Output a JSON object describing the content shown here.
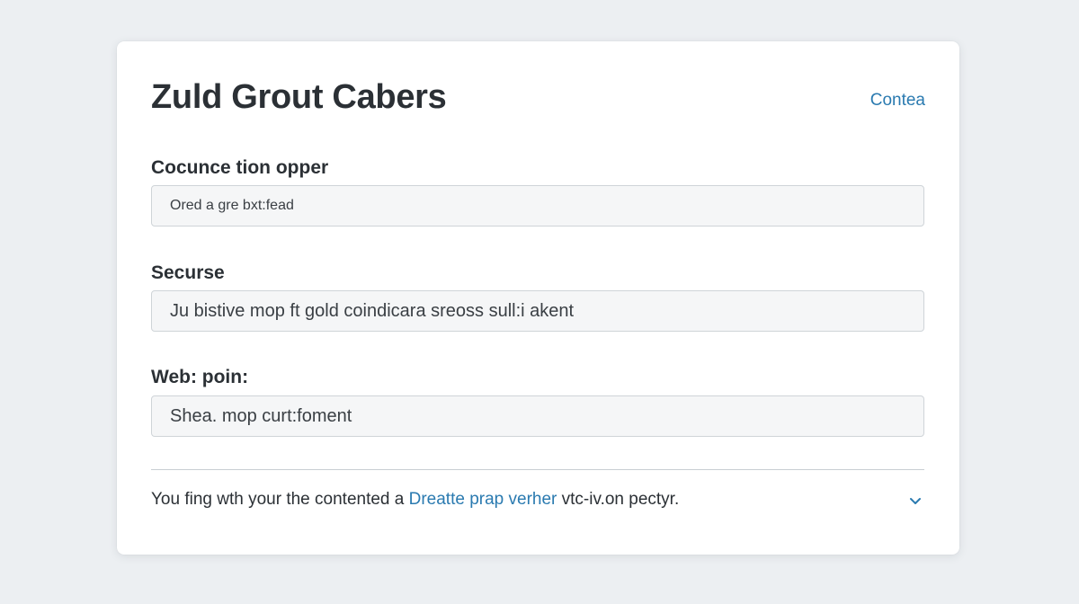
{
  "card": {
    "title": "Zuld Grout Cabers",
    "top_link": "Contea"
  },
  "fields": [
    {
      "label": "Cocunce tion opper",
      "value": "Ored a gre bxt:fead"
    },
    {
      "label": "Securse",
      "value": "Ju bistive mop ft gold coindicara sreoss sull:i akent"
    },
    {
      "label": "Web: poin:",
      "value": "Shea. mop curt:foment"
    }
  ],
  "footer": {
    "text": "You fing wth your the contented a ",
    "link": "Dreatte prap verher",
    "trailing": " vtc-iv.on pectyr.",
    "icon": "chevron-down-icon"
  },
  "colors": {
    "background": "#eceff2",
    "card": "#ffffff",
    "accent": "#2a7ab0",
    "text": "#2b3035",
    "input_bg": "#f5f6f7",
    "input_border": "#cfd4d8"
  }
}
